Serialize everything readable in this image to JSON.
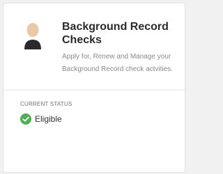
{
  "card": {
    "title": "Background Record Checks",
    "description": "Apply for, Renew and Manage your Background Record check actvities.",
    "avatar_icon": "person-avatar-icon"
  },
  "status": {
    "label": "CURRENT STATUS",
    "value": "Eligible",
    "icon": "check-circle-icon",
    "color": "#4caf50"
  }
}
